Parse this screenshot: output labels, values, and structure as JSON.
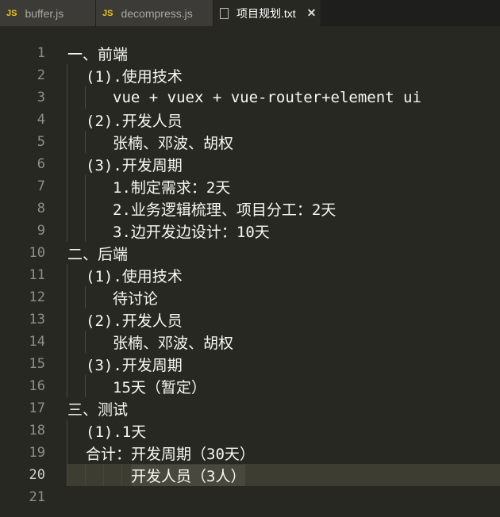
{
  "tabs": [
    {
      "label": "buffer.js",
      "icon": "js-icon",
      "badge": "JS",
      "active": false
    },
    {
      "label": "decompress.js",
      "icon": "js-icon",
      "badge": "JS",
      "active": false
    },
    {
      "label": "项目规划.txt",
      "icon": "file-text-icon",
      "active": true,
      "close": "✕"
    }
  ],
  "editor": {
    "current_line": 20,
    "lines": [
      {
        "n": "1",
        "indent": 0,
        "text": "一、前端"
      },
      {
        "n": "2",
        "indent": 1,
        "text": "(1).使用技术"
      },
      {
        "n": "3",
        "indent": 2,
        "text": "vue + vuex + vue-router+element ui"
      },
      {
        "n": "4",
        "indent": 1,
        "text": "(2).开发人员"
      },
      {
        "n": "5",
        "indent": 2,
        "text": "张楠、邓波、胡权"
      },
      {
        "n": "6",
        "indent": 1,
        "text": "(3).开发周期"
      },
      {
        "n": "7",
        "indent": 2,
        "text": "1.制定需求：2天"
      },
      {
        "n": "8",
        "indent": 2,
        "text": "2.业务逻辑梳理、项目分工：2天"
      },
      {
        "n": "9",
        "indent": 2,
        "text": "3.边开发边设计：10天"
      },
      {
        "n": "10",
        "indent": 0,
        "text": "二、后端"
      },
      {
        "n": "11",
        "indent": 1,
        "text": "(1).使用技术"
      },
      {
        "n": "12",
        "indent": 2,
        "text": "待讨论"
      },
      {
        "n": "13",
        "indent": 1,
        "text": "(2).开发人员"
      },
      {
        "n": "14",
        "indent": 2,
        "text": "张楠、邓波、胡权"
      },
      {
        "n": "15",
        "indent": 1,
        "text": "(3).开发周期"
      },
      {
        "n": "16",
        "indent": 2,
        "text": "15天（暂定）"
      },
      {
        "n": "17",
        "indent": 0,
        "text": "三、测试"
      },
      {
        "n": "18",
        "indent": 1,
        "text": "(1).1天"
      },
      {
        "n": "19",
        "indent": 1,
        "text": "合计：开发周期（30天）"
      },
      {
        "n": "20",
        "indent": 3,
        "text": "开发人员（3人）",
        "selected": true
      },
      {
        "n": "21",
        "indent": 0,
        "text": ""
      }
    ]
  }
}
